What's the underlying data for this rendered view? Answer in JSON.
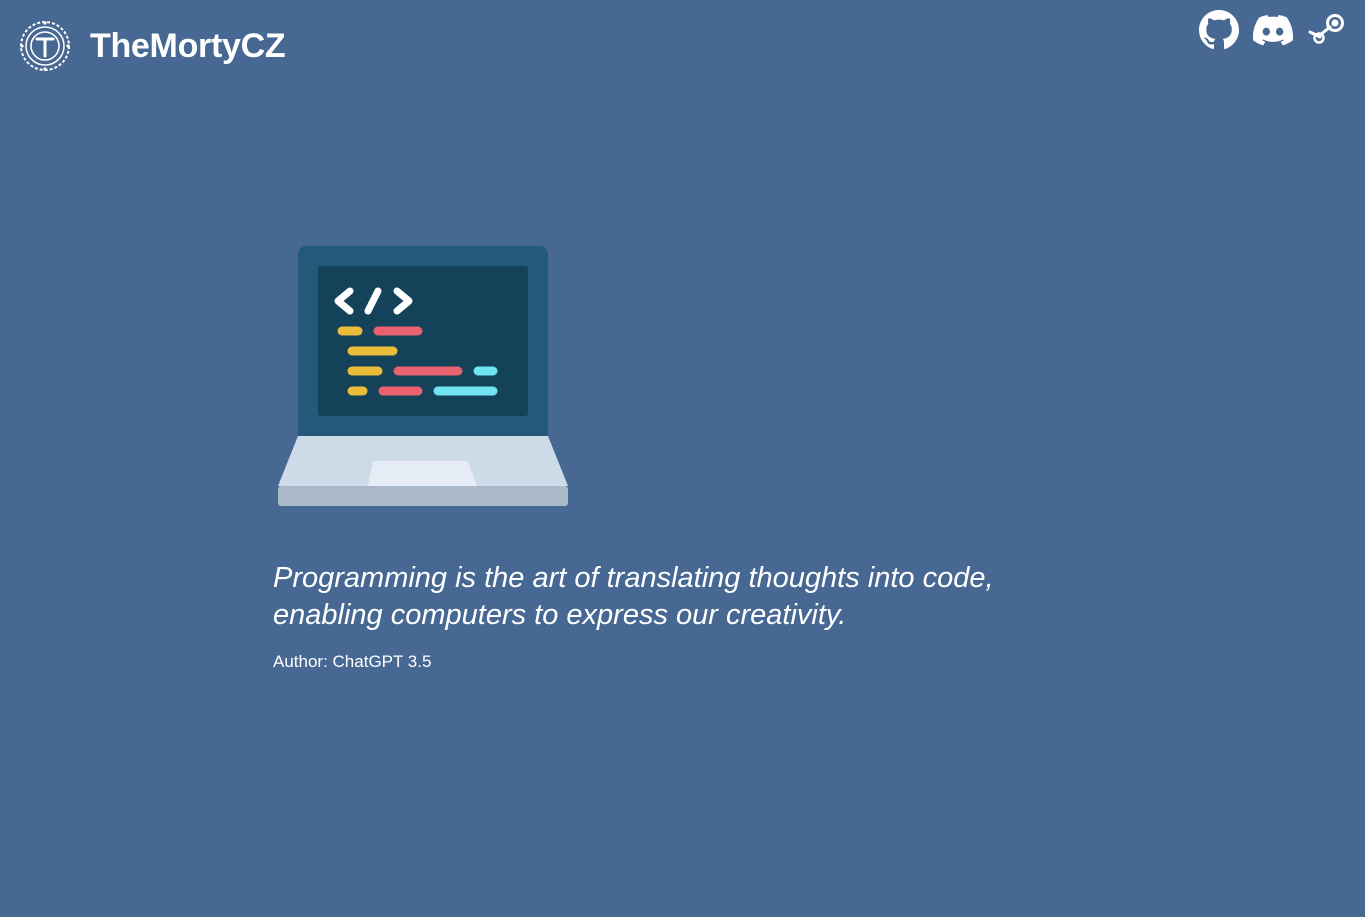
{
  "header": {
    "title": "TheMortyCZ",
    "logo_icon": "t-medallion-icon",
    "social": [
      {
        "name": "github",
        "icon": "github-icon"
      },
      {
        "name": "discord",
        "icon": "discord-icon"
      },
      {
        "name": "steam",
        "icon": "steam-icon"
      }
    ]
  },
  "main": {
    "illustration": "laptop-code-icon",
    "quote_line1": "Programming is the art of translating thoughts into code,",
    "quote_line2": "enabling computers to express our creativity.",
    "author": "Author: ChatGPT 3.5"
  },
  "colors": {
    "background": "#476892",
    "laptop_lid": "#235a7a",
    "screen": "#134259",
    "code_yellow": "#e9bc3a",
    "code_red": "#ea6170",
    "code_cyan": "#70e4f3",
    "keyboard_base": "#cddbe8",
    "laptop_bottom": "#aab9c9"
  }
}
